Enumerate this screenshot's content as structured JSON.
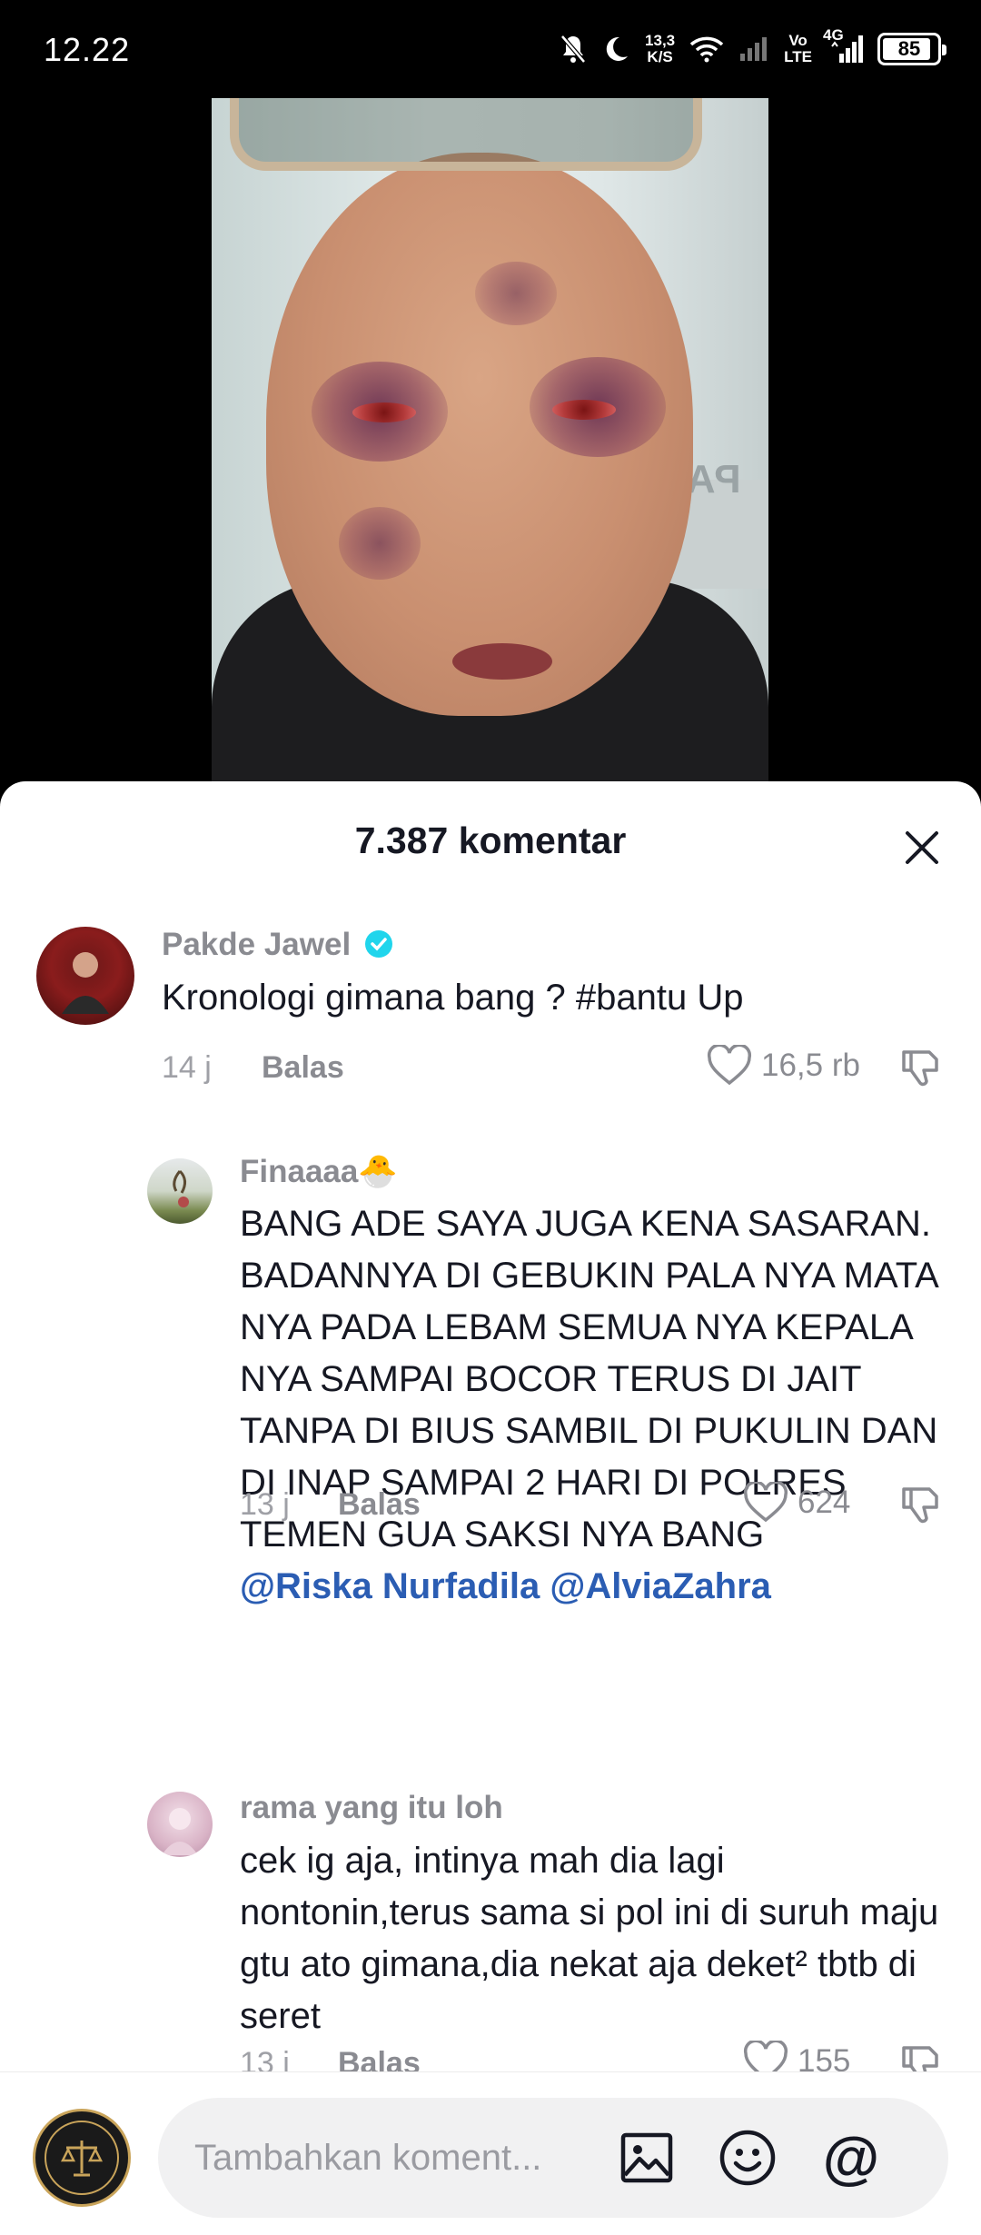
{
  "status_bar": {
    "time": "12.22",
    "net_speed_value": "13,3",
    "net_speed_unit": "K/S",
    "volte_top": "Vo",
    "volte_bottom": "LTE",
    "network": "4G",
    "battery": "85",
    "icons": [
      "mute-icon",
      "moon-icon",
      "wifi-icon",
      "signal-icon",
      "signal-icon",
      "battery-icon"
    ]
  },
  "video": {
    "sign_text": "PAR"
  },
  "comments_sheet": {
    "title": "7.387 komentar",
    "close_icon": "close-icon"
  },
  "comments": [
    {
      "author": "Pakde Jawel",
      "verified": true,
      "text": "Kronologi gimana bang ? #bantu Up",
      "time": "14 j",
      "reply_label": "Balas",
      "likes": "16,5 rb"
    },
    {
      "author": "Finaaaa🐣",
      "verified": false,
      "text": "BANG ADE SAYA JUGA KENA SASARAN. BADANNYA DI GEBUKIN PALA NYA MATA NYA PADA LEBAM SEMUA NYA KEPALA NYA SAMPAI BOCOR TERUS DI JAIT TANPA DI BIUS SAMBIL DI PUKULIN DAN DI INAP SAMPAI 2 HARI DI POLRES TEMEN GUA SAKSI NYA BANG",
      "mentions": [
        "@Riska Nurfadila",
        "@AlviaZahra"
      ],
      "time": "13 j",
      "reply_label": "Balas",
      "likes": "624"
    },
    {
      "author": "rama yang itu loh",
      "verified": false,
      "text": "cek ig aja, intinya mah dia lagi nontonin,terus sama si pol ini di suruh maju gtu ato gimana,dia nekat aja deket² tbtb di seret",
      "time": "13 j",
      "reply_label": "Balas",
      "likes": "155"
    }
  ],
  "input_bar": {
    "placeholder": "Tambahkan koment...",
    "icons": [
      "image-icon",
      "emoji-icon",
      "mention-icon"
    ],
    "mention_symbol": "@"
  }
}
